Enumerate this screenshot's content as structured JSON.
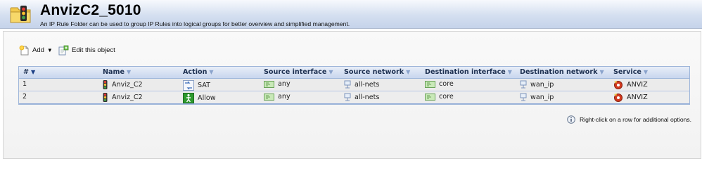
{
  "header": {
    "title": "AnvizC2_5010",
    "subtitle": "An IP Rule Folder can be used to group IP Rules into logical groups for better overview and simplified management.",
    "icon": "folder-traffic-light-icon"
  },
  "toolbar": {
    "add_label": "Add",
    "edit_label": "Edit this object"
  },
  "table": {
    "columns": [
      {
        "label": "#",
        "sorted": true
      },
      {
        "label": "Name"
      },
      {
        "label": "Action"
      },
      {
        "label": "Source interface"
      },
      {
        "label": "Source network"
      },
      {
        "label": "Destination interface"
      },
      {
        "label": "Destination network"
      },
      {
        "label": "Service"
      }
    ],
    "rows": [
      {
        "num": "1",
        "name": "Anviz_C2",
        "action": "SAT",
        "action_icon": "sat-icon",
        "src_if": "any",
        "src_net": "all-nets",
        "dst_if": "core",
        "dst_net": "wan_ip",
        "service": "ANVIZ"
      },
      {
        "num": "2",
        "name": "Anviz_C2",
        "action": "Allow",
        "action_icon": "allow-icon",
        "src_if": "any",
        "src_net": "all-nets",
        "dst_if": "core",
        "dst_net": "wan_ip",
        "service": "ANVIZ"
      }
    ]
  },
  "hint": "Right-click on a row for additional options.",
  "colors": {
    "header_bg": "#c5d3ea",
    "grid_border": "#9eb6da",
    "allow_green": "#2e9a2e",
    "service_red": "#d33a1f"
  }
}
